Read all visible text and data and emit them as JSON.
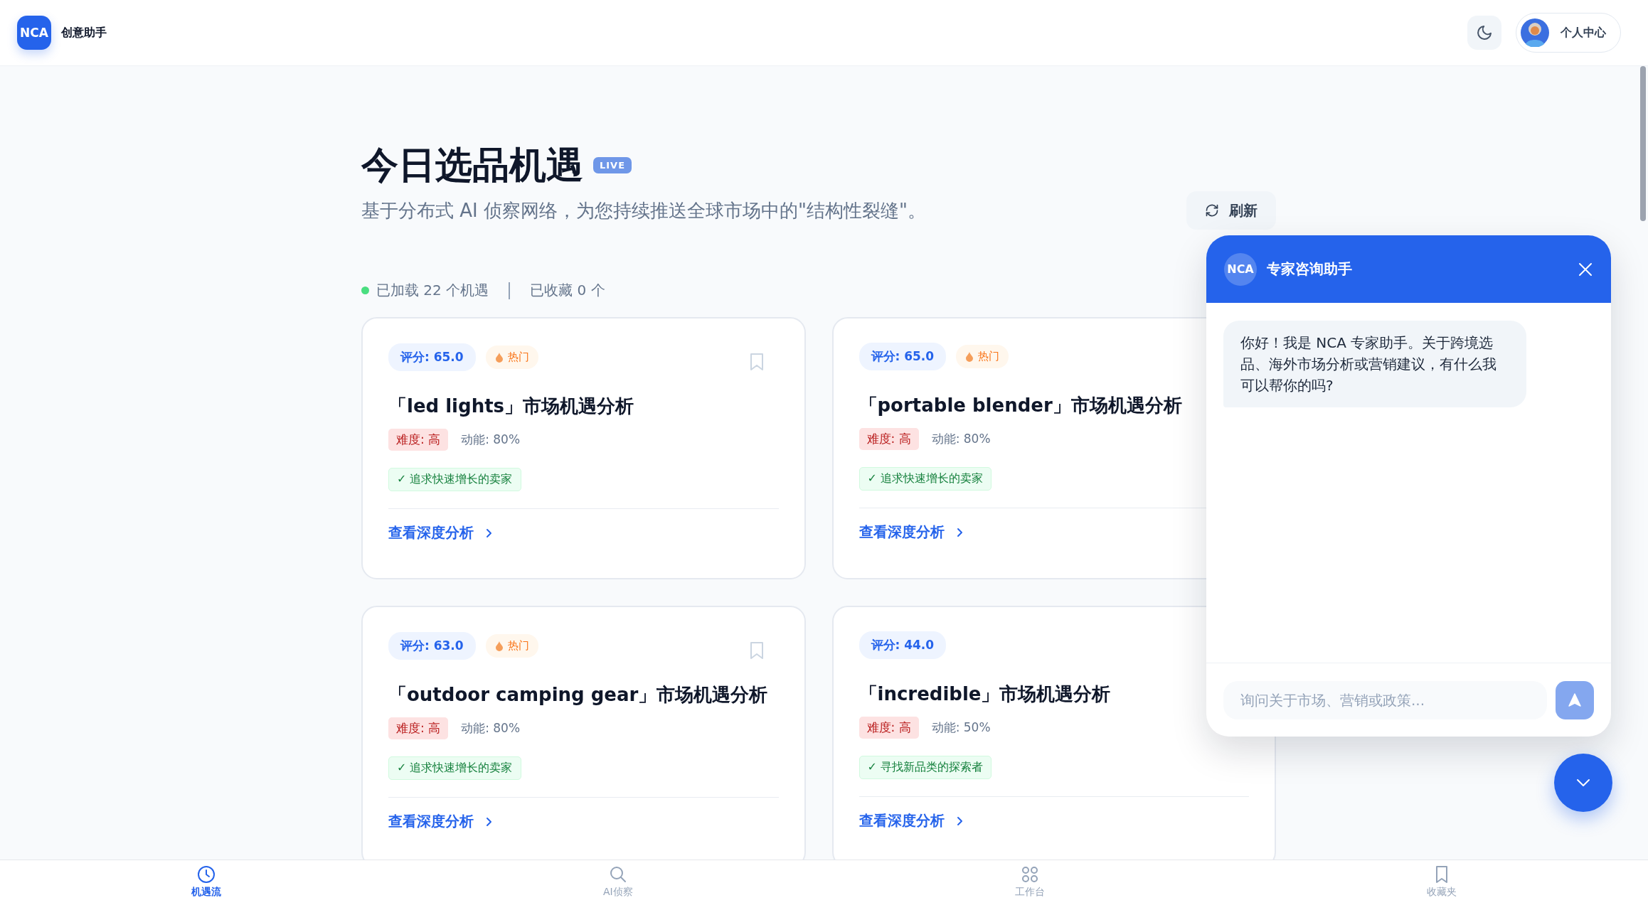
{
  "app": {
    "logo": "NCA",
    "name": "创意助手"
  },
  "header": {
    "user_label": "个人中心"
  },
  "page": {
    "title": "今日选品机遇",
    "badge": "LIVE",
    "subtitle": "基于分布式 AI 侦察网络，为您持续推送全球市场中的\"结构性裂缝\"。",
    "refresh_label": "刷新",
    "stats": {
      "loaded": "已加载 22 个机遇",
      "saved": "已收藏 0 个"
    }
  },
  "cards": [
    {
      "score": "评分: 65.0",
      "hot": "热门",
      "saved": false,
      "title": "「led lights」市场机遇分析",
      "difficulty": "难度: 高",
      "momentum": "动能: 80%",
      "tag": "✓ 追求快速增长的卖家",
      "link": "查看深度分析"
    },
    {
      "score": "评分: 65.0",
      "hot": "热门",
      "title": "「portable blender」市场机遇分析",
      "difficulty": "难度: 高",
      "momentum": "动能: 80%",
      "tag": "✓ 追求快速增长的卖家",
      "link": "查看深度分析"
    },
    {
      "score": "评分: 63.0",
      "hot": "热门",
      "saved": false,
      "title": "「outdoor camping gear」市场机遇分析",
      "difficulty": "难度: 高",
      "momentum": "动能: 80%",
      "tag": "✓ 追求快速增长的卖家",
      "link": "查看深度分析"
    },
    {
      "score": "评分: 44.0",
      "title": "「incredible」市场机遇分析",
      "difficulty": "难度: 高",
      "momentum": "动能: 50%",
      "tag": "✓ 寻找新品类的探索者",
      "link": "查看深度分析"
    }
  ],
  "chat": {
    "avatar": "NCA",
    "title": "专家咨询助手",
    "messages": [
      {
        "text": "你好！我是 NCA 专家助手。关于跨境选品、海外市场分析或营销建议，有什么我可以帮你的吗?"
      }
    ],
    "input": {
      "placeholder": "询问关于市场、营销或政策..."
    }
  },
  "nav": [
    {
      "label": "机遇流",
      "selected": true
    },
    {
      "label": "AI侦察",
      "selected": false
    },
    {
      "label": "工作台",
      "selected": false
    },
    {
      "label": "收藏夹",
      "selected": false
    }
  ]
}
